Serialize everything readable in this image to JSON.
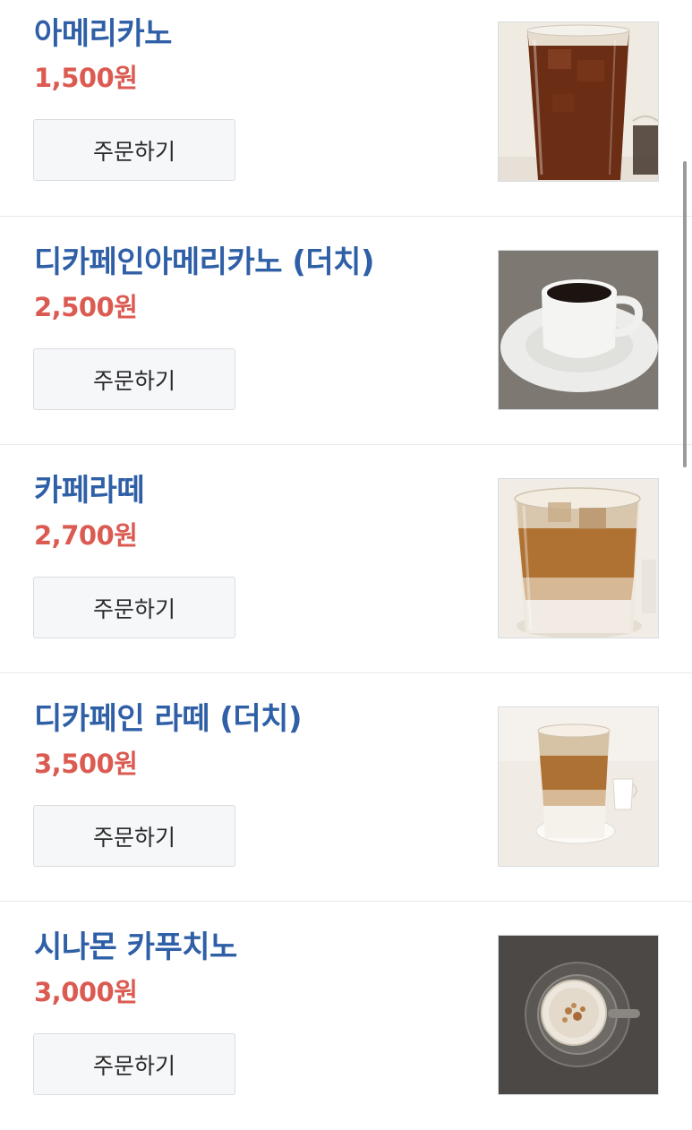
{
  "menu": {
    "items": [
      {
        "name": "아메리카노",
        "price": "1,500원",
        "order_label": "주문하기",
        "image": "iced-americano"
      },
      {
        "name": "디카페인아메리카노 (더치)",
        "price": "2,500원",
        "order_label": "주문하기",
        "image": "hot-coffee-cup"
      },
      {
        "name": "카페라떼",
        "price": "2,700원",
        "order_label": "주문하기",
        "image": "iced-latte"
      },
      {
        "name": "디카페인 라떼 (더치)",
        "price": "3,500원",
        "order_label": "주문하기",
        "image": "iced-latte-small"
      },
      {
        "name": "시나몬 카푸치노",
        "price": "3,000원",
        "order_label": "주문하기",
        "image": "cappuccino-top"
      }
    ]
  },
  "colors": {
    "name": "#2f5fa6",
    "price": "#db5b52",
    "button_bg": "#f6f7f9"
  }
}
